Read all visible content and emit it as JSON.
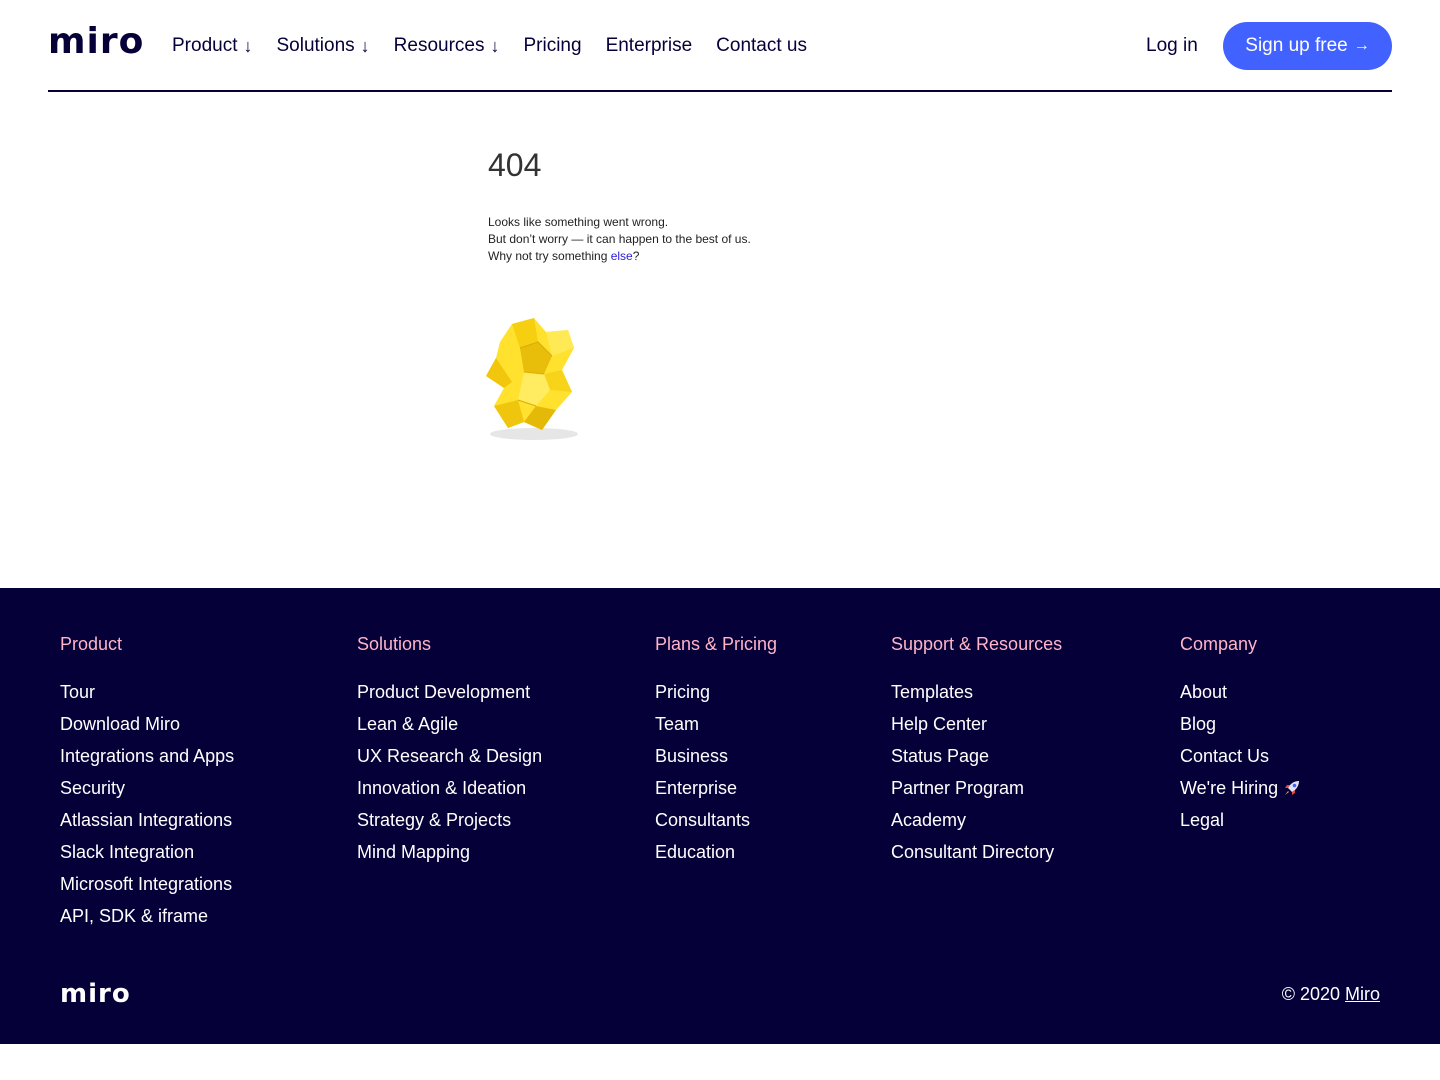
{
  "header": {
    "logo_text": "miro",
    "nav": [
      {
        "label": "Product",
        "arrow": "↓"
      },
      {
        "label": "Solutions",
        "arrow": "↓"
      },
      {
        "label": "Resources",
        "arrow": "↓"
      },
      {
        "label": "Pricing",
        "arrow": ""
      },
      {
        "label": "Enterprise",
        "arrow": ""
      },
      {
        "label": "Contact us",
        "arrow": ""
      }
    ],
    "login_label": "Log in",
    "signup_label": "Sign up free",
    "signup_arrow": "→"
  },
  "main": {
    "error_code": "404",
    "line1": "Looks like something went wrong.",
    "line2": "But don’t worry — it can happen to the best of us.",
    "line3_prefix": "Why not try something ",
    "line3_link": "else",
    "line3_suffix": "?"
  },
  "footer": {
    "columns": [
      {
        "title": "Product",
        "links": [
          "Tour",
          "Download Miro",
          "Integrations and Apps",
          "Security",
          "Atlassian Integrations",
          "Slack Integration",
          "Microsoft Integrations",
          "API, SDK & iframe"
        ]
      },
      {
        "title": "Solutions",
        "links": [
          "Product Development",
          "Lean & Agile",
          "UX Research & Design",
          "Innovation & Ideation",
          "Strategy & Projects",
          "Mind Mapping"
        ]
      },
      {
        "title": "Plans & Pricing",
        "links": [
          "Pricing",
          "Team",
          "Business",
          "Enterprise",
          "Consultants",
          "Education"
        ]
      },
      {
        "title": "Support & Resources",
        "links": [
          "Templates",
          "Help Center",
          "Status Page",
          "Partner Program",
          "Academy",
          "Consultant Directory"
        ]
      },
      {
        "title": "Company",
        "links": [
          "About",
          "Blog",
          "Contact Us",
          "We're Hiring",
          "Legal"
        ]
      }
    ],
    "logo_text": "miro",
    "copyright_prefix": "© 2020 ",
    "copyright_link": "Miro"
  },
  "colors": {
    "brand_navy": "#050038",
    "accent_blue": "#4262ff",
    "footer_heading": "#ffb4c8",
    "paper_yellow": "#ffe12e"
  },
  "icons": {
    "hiring_icon": "rocket-icon",
    "error_illustration": "crumpled-paper-icon"
  }
}
